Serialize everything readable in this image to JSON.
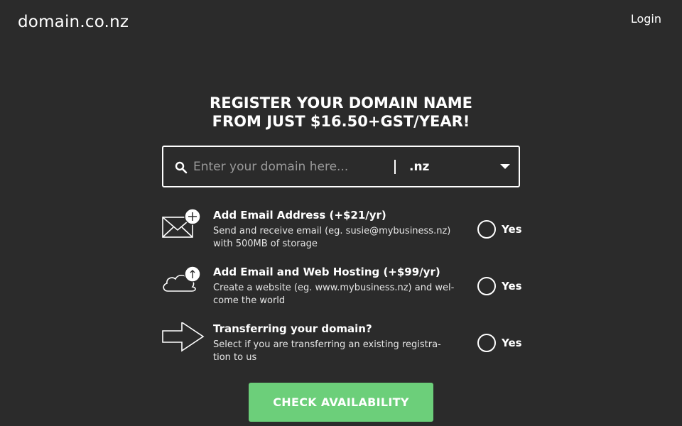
{
  "header": {
    "logo": "domain.co.nz",
    "login_label": "Login"
  },
  "hero": {
    "headline_line1": "REGISTER YOUR DOMAIN NAME",
    "headline_line2": "FROM JUST $16.50+GST/YEAR!"
  },
  "search": {
    "placeholder": "Enter your domain here...",
    "value": "",
    "tld_selected": ".nz",
    "icon": "search-icon"
  },
  "options": [
    {
      "title": "Add Email Address (+$21/yr)",
      "desc_line1": "Send and receive email (eg. susie@mybusiness.nz)",
      "desc_line2": "with 500MB of storage",
      "radio_label": "Yes",
      "icon": "envelope-plus-icon",
      "checked": false
    },
    {
      "title": "Add Email and Web Hosting (+$99/yr)",
      "desc_line1": "Create a website (eg. www.mybusiness.nz) and wel-",
      "desc_line2": "come the world",
      "radio_label": "Yes",
      "icon": "cloud-upload-icon",
      "checked": false
    },
    {
      "title": "Transferring your domain?",
      "desc_line1": "Select if you are transferring an existing registra-",
      "desc_line2": "tion to us",
      "radio_label": "Yes",
      "icon": "arrow-right-icon",
      "checked": false
    }
  ],
  "cta": {
    "label": "CHECK AVAILABILITY",
    "color": "#6ccf7a"
  },
  "colors": {
    "background": "#2b2b2b",
    "text": "#ffffff"
  }
}
